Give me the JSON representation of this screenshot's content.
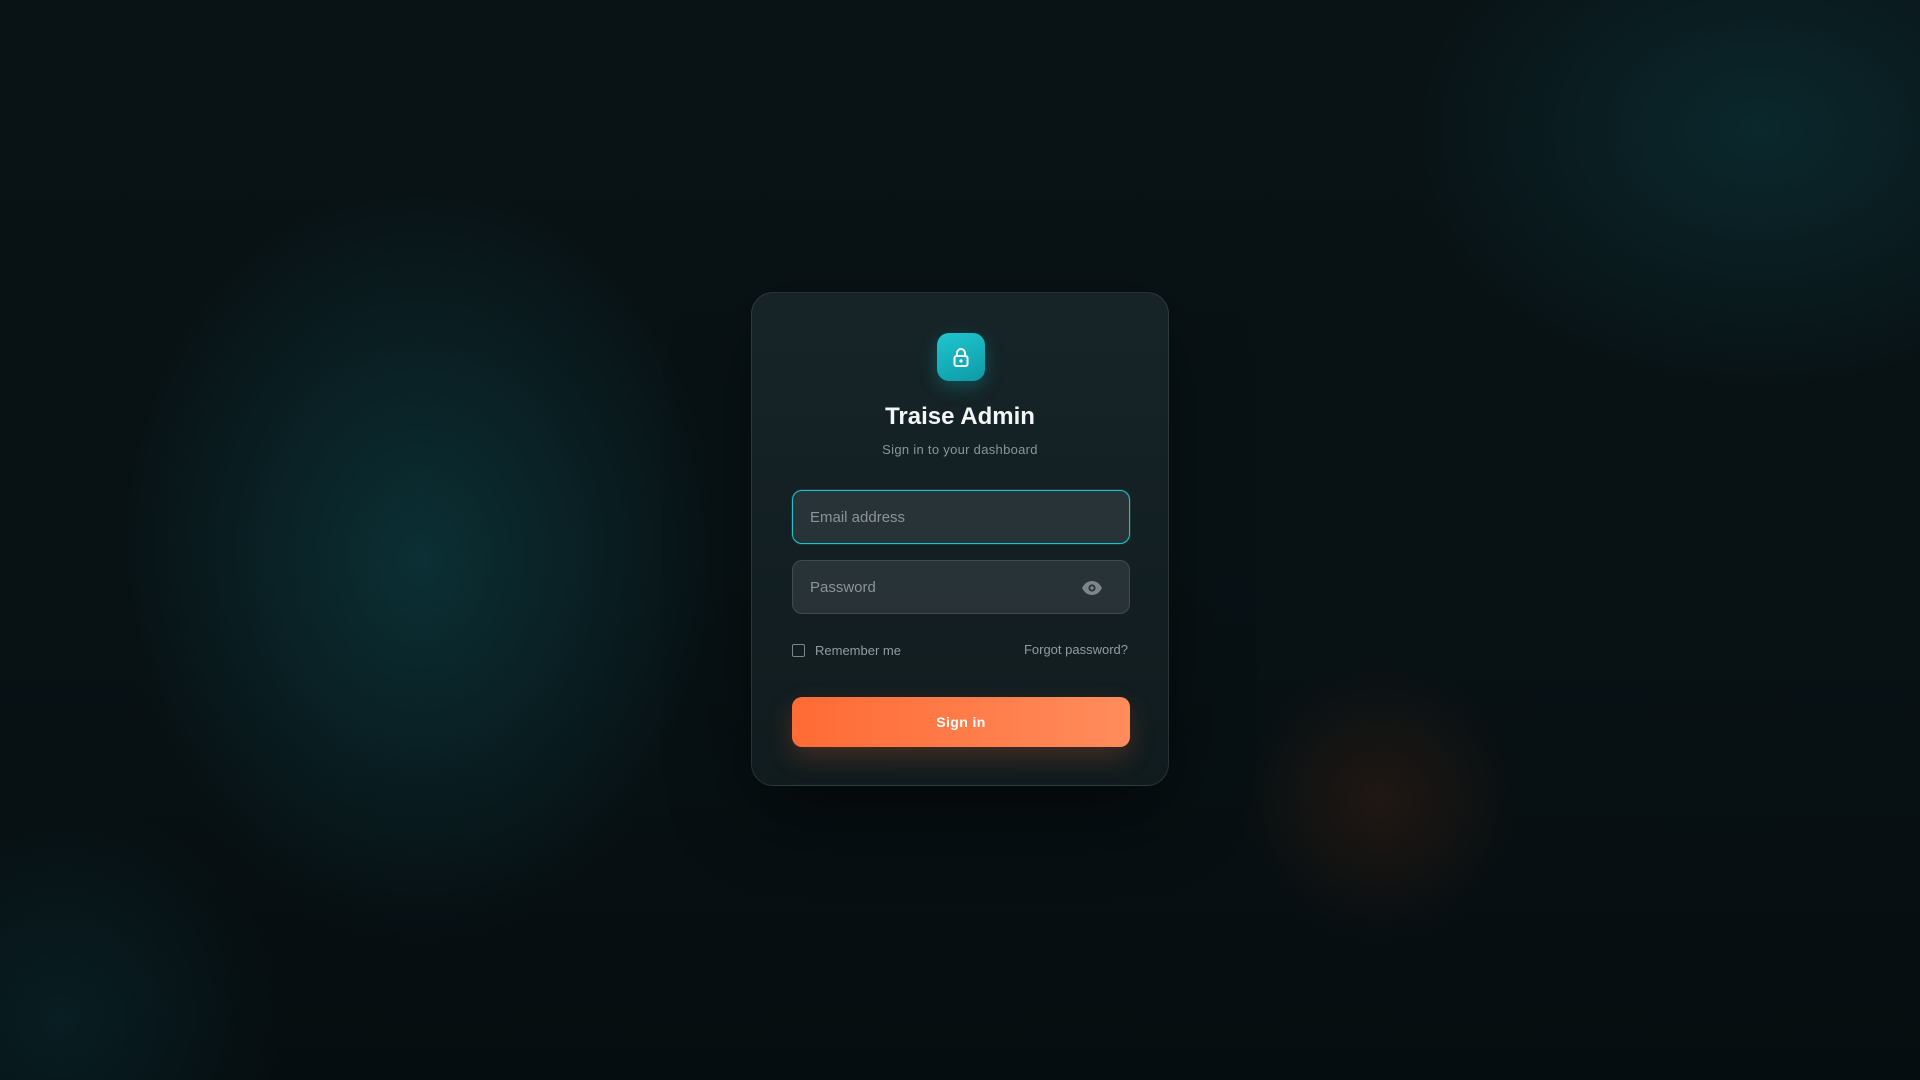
{
  "app": {
    "title": "Traise Admin",
    "subtitle": "Sign in to your dashboard",
    "badge_icon": "lock-icon"
  },
  "form": {
    "email": {
      "value": "",
      "placeholder": "Email address",
      "focused": true
    },
    "password": {
      "value": "",
      "placeholder": "Password",
      "toggle_icon": "eye-icon"
    },
    "remember": {
      "label": "Remember me",
      "checked": false
    },
    "forgot_label": "Forgot password?",
    "submit_label": "Sign in"
  },
  "colors": {
    "accent": "#1fc3cc",
    "primary_button": "#ff6b35",
    "background": "#071013"
  }
}
